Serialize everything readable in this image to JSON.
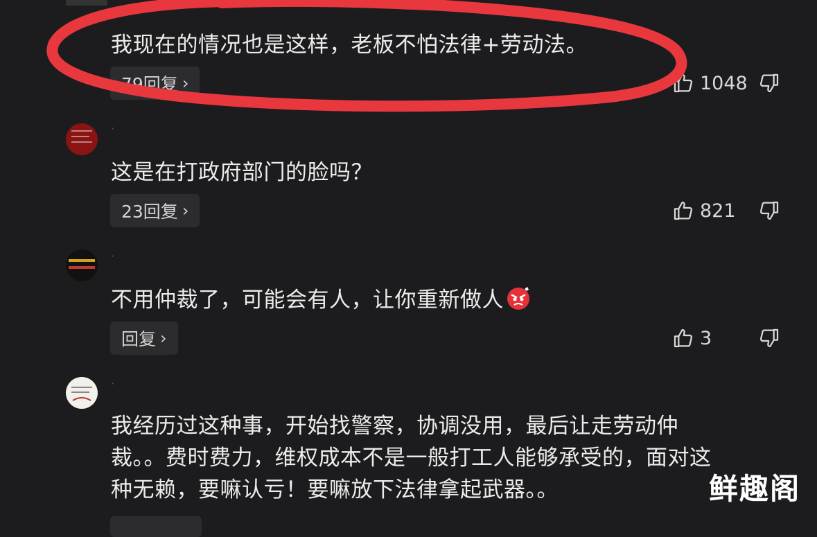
{
  "comments": [
    {
      "text": "我现在的情况也是这样，老板不怕法律+劳动法。",
      "reply_label": "79回复",
      "likes": "1048"
    },
    {
      "text": "这是在打政府部门的脸吗？",
      "reply_label": "23回复",
      "likes": "821"
    },
    {
      "text": "不用仲裁了，可能会有人，让你重新做人",
      "reply_label": "回复",
      "likes": "3"
    },
    {
      "text_line1": "我经历过这种事，开始找警察，协调没用，最后让走劳动仲",
      "text_line2": "裁。。费时费力，维权成本不是一般打工人能够承受的，面对这",
      "text_line3": "种无赖，要嘛认亏！要嘛放下法律拿起武器。。"
    }
  ],
  "watermark": "鲜趣阁",
  "colors": {
    "background": "#1c1c1e",
    "annotation_red": "#e8383d",
    "reply_button_bg": "#2c2c2e"
  },
  "icons": {
    "like": "thumbs-up-icon",
    "dislike": "thumbs-down-icon",
    "reply_chevron": "chevron-right-icon"
  }
}
